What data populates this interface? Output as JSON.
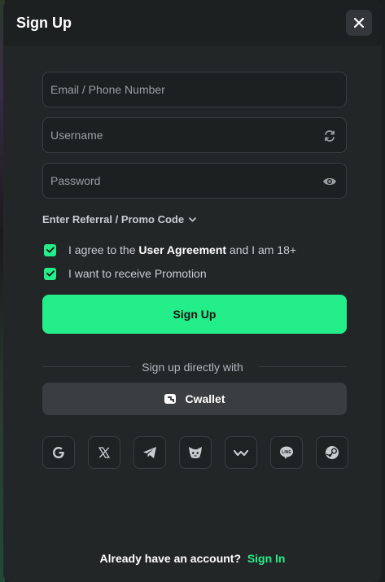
{
  "dialog": {
    "title": "Sign Up",
    "close_icon": "close-icon"
  },
  "form": {
    "email_placeholder": "Email / Phone Number",
    "username_placeholder": "Username",
    "password_placeholder": "Password",
    "referral_label": "Enter Referral / Promo Code",
    "agree_prefix": "I agree to the ",
    "agree_link": "User Agreement",
    "agree_suffix": " and I am 18+",
    "agree_checked": true,
    "promotion_label": "I want to receive Promotion",
    "promotion_checked": true,
    "submit_label": "Sign Up"
  },
  "alternate": {
    "divider_text": "Sign up directly with",
    "cwallet_label": "Cwallet",
    "social_providers": [
      "google-icon",
      "x-icon",
      "telegram-icon",
      "metamask-icon",
      "walletconnect-icon",
      "line-icon",
      "steam-icon"
    ]
  },
  "footer": {
    "prompt": "Already have an account? ",
    "signin_label": "Sign In"
  },
  "colors": {
    "accent": "#24ee89",
    "background": "#232627",
    "field_border": "#3a3e41"
  }
}
